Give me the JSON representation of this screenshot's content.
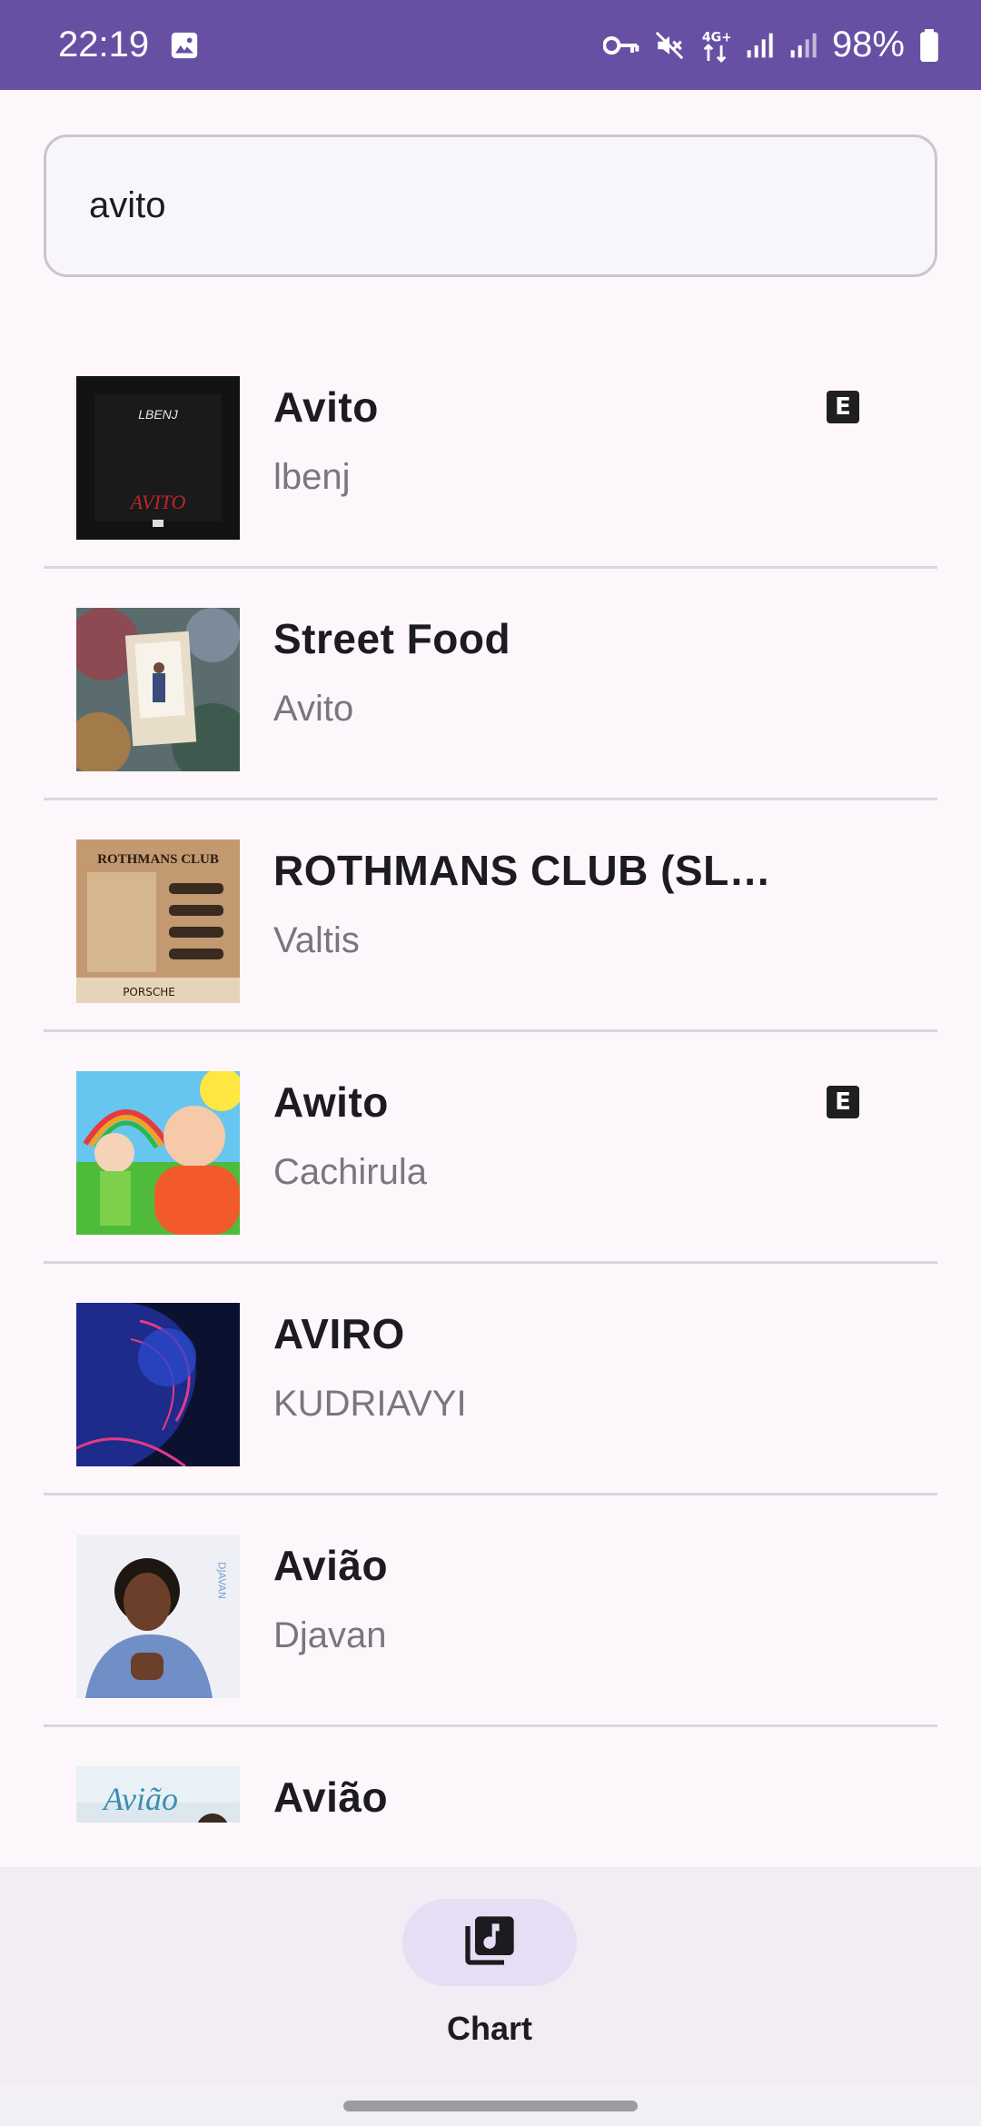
{
  "status_bar": {
    "time": "22:19",
    "battery": "98%",
    "icons": [
      "image-icon",
      "vpn-key-icon",
      "mute-icon",
      "4g-data-icon",
      "signal-icon",
      "signal-icon",
      "battery-icon"
    ]
  },
  "search": {
    "value": "avito",
    "placeholder": ""
  },
  "results": [
    {
      "title": "Avito",
      "artist": "lbenj",
      "explicit": true
    },
    {
      "title": "Street Food",
      "artist": "Avito",
      "explicit": false
    },
    {
      "title": "ROTHMANS CLUB (SL…",
      "artist": "Valtis",
      "explicit": false
    },
    {
      "title": "Awito",
      "artist": "Cachirula",
      "explicit": true
    },
    {
      "title": "AVIRO",
      "artist": "KUDRIAVYI",
      "explicit": false
    },
    {
      "title": "Avião",
      "artist": "Djavan",
      "explicit": false
    },
    {
      "title": "Avião",
      "artist": "",
      "explicit": false
    }
  ],
  "explicit_label": "E",
  "covers": {
    "lbenj_text": "LBENJ",
    "avito_text": "AVITO",
    "rothmans_text": "ROTHMANS CLUB",
    "porsche_text": "PORSCHE",
    "djavan_text": "DJAVAN",
    "aviao_text": "Avião"
  },
  "bottom_nav": {
    "chart_label": "Chart",
    "icon": "music-library-icon"
  },
  "colors": {
    "status_bar": "#6750a4",
    "background": "#fdf7fc",
    "nav_background": "#f2ecf5",
    "nav_pill": "#e7def5"
  }
}
